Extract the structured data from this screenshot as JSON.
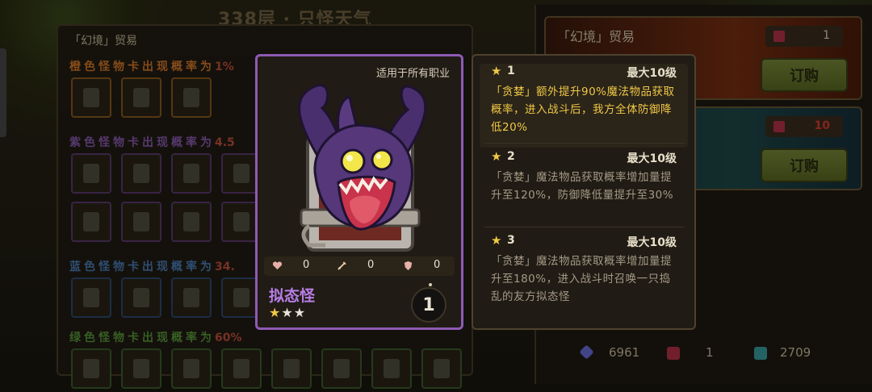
{
  "background": {
    "floor_title": "338层 · 只怪天气",
    "trade_panel": {
      "title": "「幻境」贸易",
      "rarities": [
        {
          "label": "橙色怪物卡出现概率为",
          "pct": "1%",
          "color": "#d77a2a"
        },
        {
          "label": "紫色怪物卡出现概率为",
          "pct": "4.5",
          "color": "#8a5cb0"
        },
        {
          "label": "蓝色怪物卡出现概率为",
          "pct": "34.",
          "color": "#4d7fb8"
        },
        {
          "label": "绿色怪物卡出现概率为",
          "pct": "60%",
          "color": "#5a9a3a"
        }
      ]
    }
  },
  "shop": {
    "cards": [
      {
        "title": "「幻境」贸易",
        "price": "1",
        "button": "订购"
      },
      {
        "title": "",
        "price": "10",
        "button": "订购"
      }
    ],
    "currencies": [
      {
        "icon": "gem-icon",
        "value": "6961",
        "color": "#6a6fd8"
      },
      {
        "icon": "ticket-icon",
        "value": "1",
        "color": "#b8324a"
      },
      {
        "icon": "scroll-icon",
        "value": "2709",
        "color": "#3aa0a0"
      }
    ]
  },
  "monster": {
    "applies_to": "适用于所有职业",
    "name": "拟态怪",
    "stars_filled": 1,
    "stars_total": 3,
    "star_glyph": "★",
    "level": "1",
    "stats": [
      {
        "icon": "heart-icon",
        "value": "0",
        "color": "#e8b0a8"
      },
      {
        "icon": "sword-icon",
        "value": "0",
        "color": "#e8c8a8"
      },
      {
        "icon": "shield-icon",
        "value": "0",
        "color": "#e8b0a8"
      }
    ],
    "border_color": "#8e5ab4"
  },
  "skills": [
    {
      "star": "★",
      "level": "1",
      "max": "最大10级",
      "desc": "「贪婪」额外提升90%魔法物品获取概率，进入战斗后，我方全体防御降低20%",
      "active": true
    },
    {
      "star": "★",
      "level": "2",
      "max": "最大10级",
      "desc": "「贪婪」魔法物品获取概率增加量提升至120%，防御降低量提升至30%",
      "active": false
    },
    {
      "star": "★",
      "level": "3",
      "max": "最大10级",
      "desc": "「贪婪」魔法物品获取概率增加量提升至180%，进入战斗时召唤一只捣乱的友方拟态怪",
      "active": false
    }
  ]
}
